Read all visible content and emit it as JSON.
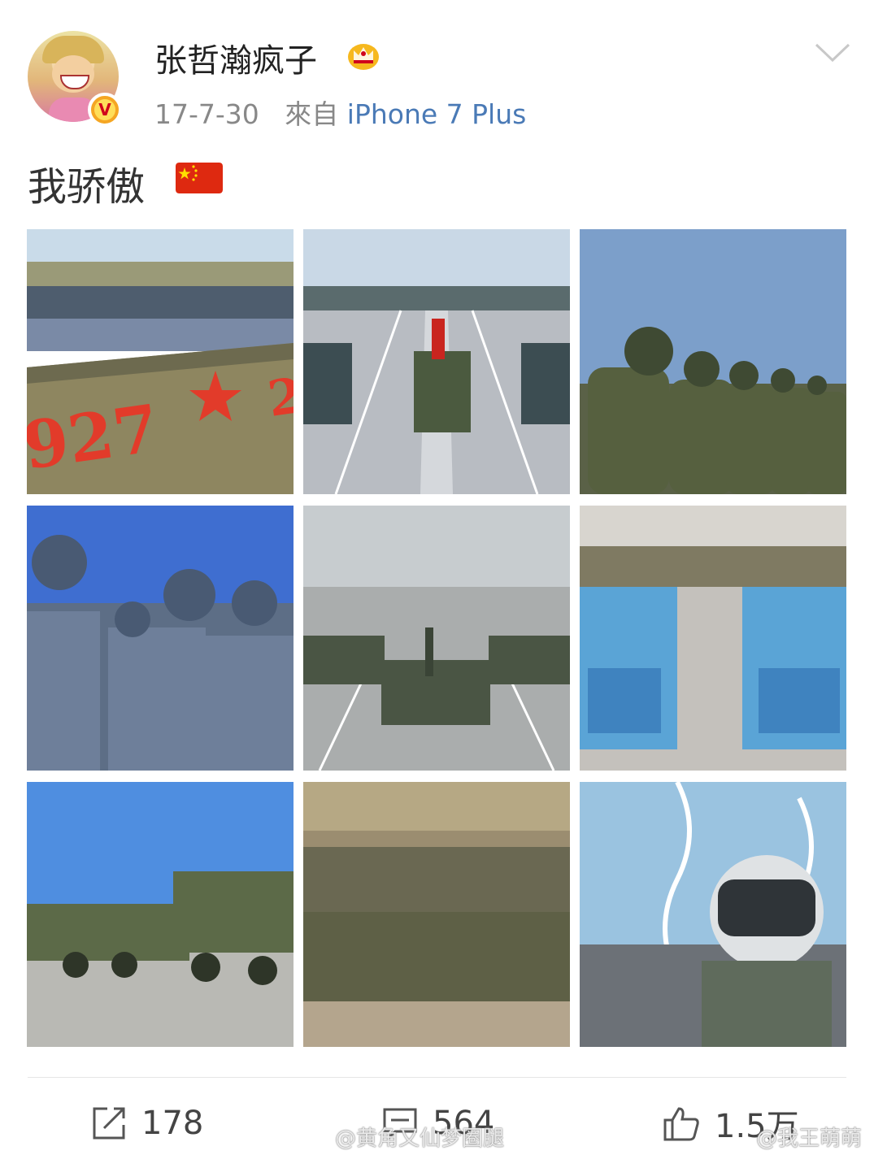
{
  "post": {
    "username": "张哲瀚疯子",
    "date": "17-7-30",
    "from_label": "來自",
    "source": "iPhone 7 Plus",
    "text": "我骄傲"
  },
  "images": [
    {
      "caption_fragment_1": "927",
      "caption_fragment_2": "2"
    },
    {},
    {},
    {},
    {},
    {},
    {},
    {},
    {}
  ],
  "actions": {
    "repost_count": "178",
    "comment_count": "564",
    "like_count": "1.5万"
  },
  "watermarks": {
    "left": "@黄角又仙梦圈腿",
    "right": "@我王萌萌"
  },
  "colors": {
    "source_link": "#4a7ab6",
    "meta_gray": "#888888",
    "badge_orange": "#f5a623",
    "flag_red": "#de2910",
    "flag_star": "#ffde00"
  },
  "icons": {
    "verified": "v-badge-icon",
    "crown": "crown-icon",
    "menu": "chevron-down-icon",
    "repost": "repost-icon",
    "comment": "comment-icon",
    "like": "thumbs-up-icon"
  }
}
